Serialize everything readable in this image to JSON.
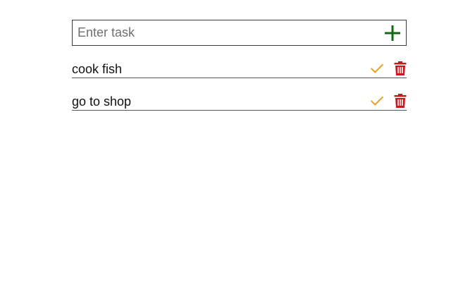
{
  "task_form": {
    "input_value": "",
    "input_placeholder": "Enter task",
    "add_icon": "plus-icon"
  },
  "tasks": [
    {
      "text": "cook fish",
      "complete_icon": "checkmark-icon",
      "delete_icon": "trash-icon"
    },
    {
      "text": "go to shop",
      "complete_icon": "checkmark-icon",
      "delete_icon": "trash-icon"
    }
  ],
  "colors": {
    "add_icon": "#0f6b0f",
    "complete_icon": "#e8a21c",
    "delete_icon": "#c8171e",
    "border": "#3a3a3a",
    "text": "#111111",
    "placeholder": "#6f6f6f"
  }
}
